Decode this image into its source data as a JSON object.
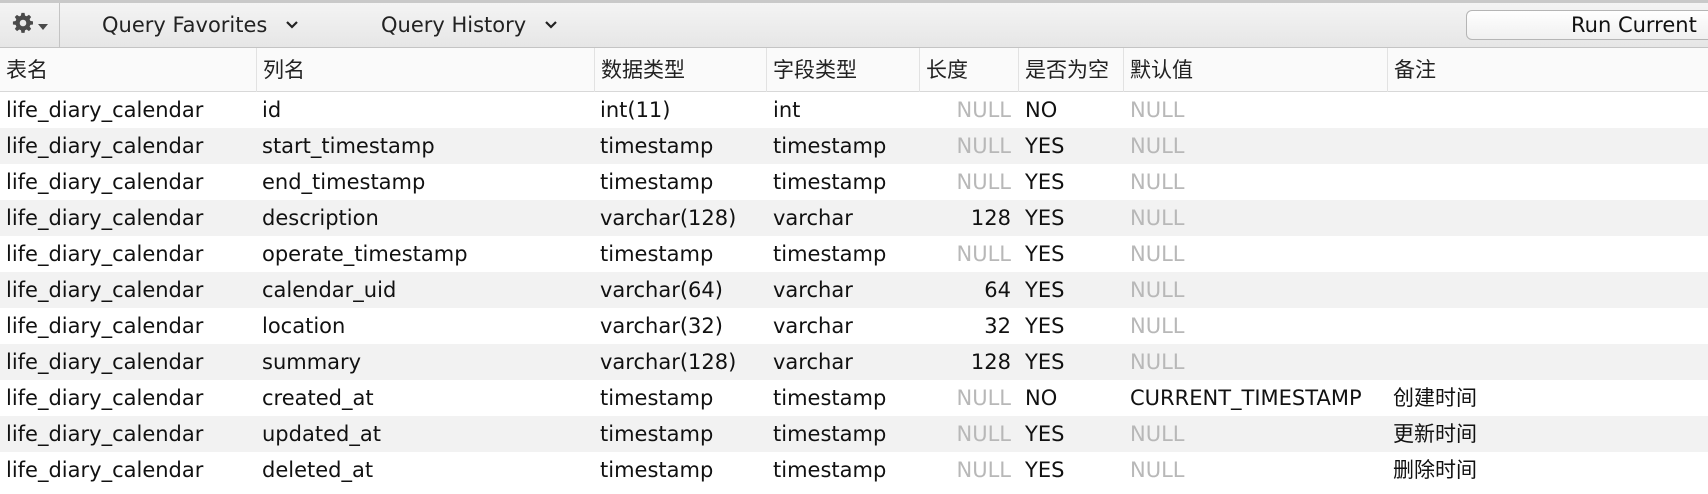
{
  "toolbar": {
    "favorites_label": "Query Favorites",
    "history_label": "Query History",
    "run_label": "Run Current"
  },
  "columns": [
    "表名",
    "列名",
    "数据类型",
    "字段类型",
    "长度",
    "是否为空",
    "默认值",
    "备注"
  ],
  "rows": [
    {
      "table": "life_diary_calendar",
      "column": "id",
      "data_type": "int(11)",
      "field_type": "int",
      "length": "NULL",
      "nullable": "NO",
      "default": "NULL",
      "comment": ""
    },
    {
      "table": "life_diary_calendar",
      "column": "start_timestamp",
      "data_type": "timestamp",
      "field_type": "timestamp",
      "length": "NULL",
      "nullable": "YES",
      "default": "NULL",
      "comment": ""
    },
    {
      "table": "life_diary_calendar",
      "column": "end_timestamp",
      "data_type": "timestamp",
      "field_type": "timestamp",
      "length": "NULL",
      "nullable": "YES",
      "default": "NULL",
      "comment": ""
    },
    {
      "table": "life_diary_calendar",
      "column": "description",
      "data_type": "varchar(128)",
      "field_type": "varchar",
      "length": "128",
      "nullable": "YES",
      "default": "NULL",
      "comment": ""
    },
    {
      "table": "life_diary_calendar",
      "column": "operate_timestamp",
      "data_type": "timestamp",
      "field_type": "timestamp",
      "length": "NULL",
      "nullable": "YES",
      "default": "NULL",
      "comment": ""
    },
    {
      "table": "life_diary_calendar",
      "column": "calendar_uid",
      "data_type": "varchar(64)",
      "field_type": "varchar",
      "length": "64",
      "nullable": "YES",
      "default": "NULL",
      "comment": ""
    },
    {
      "table": "life_diary_calendar",
      "column": "location",
      "data_type": "varchar(32)",
      "field_type": "varchar",
      "length": "32",
      "nullable": "YES",
      "default": "NULL",
      "comment": ""
    },
    {
      "table": "life_diary_calendar",
      "column": "summary",
      "data_type": "varchar(128)",
      "field_type": "varchar",
      "length": "128",
      "nullable": "YES",
      "default": "NULL",
      "comment": ""
    },
    {
      "table": "life_diary_calendar",
      "column": "created_at",
      "data_type": "timestamp",
      "field_type": "timestamp",
      "length": "NULL",
      "nullable": "NO",
      "default": "CURRENT_TIMESTAMP",
      "comment": "创建时间"
    },
    {
      "table": "life_diary_calendar",
      "column": "updated_at",
      "data_type": "timestamp",
      "field_type": "timestamp",
      "length": "NULL",
      "nullable": "YES",
      "default": "NULL",
      "comment": "更新时间"
    },
    {
      "table": "life_diary_calendar",
      "column": "deleted_at",
      "data_type": "timestamp",
      "field_type": "timestamp",
      "length": "NULL",
      "nullable": "YES",
      "default": "NULL",
      "comment": "删除时间"
    }
  ]
}
